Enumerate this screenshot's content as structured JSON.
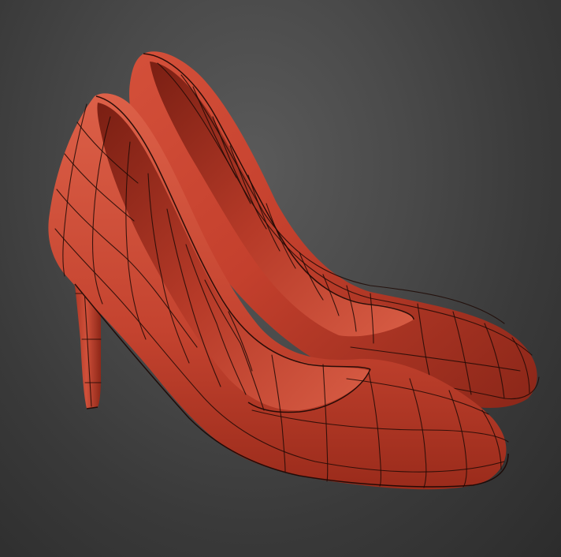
{
  "viewport": {
    "background": "#444444",
    "material_color": "#c0402e",
    "wireframe_color": "#1e0905"
  },
  "scene": {
    "objects": [
      {
        "name": "high-heel-pump-back",
        "icon": "shoe-icon"
      },
      {
        "name": "high-heel-pump-front",
        "icon": "shoe-icon"
      }
    ]
  }
}
